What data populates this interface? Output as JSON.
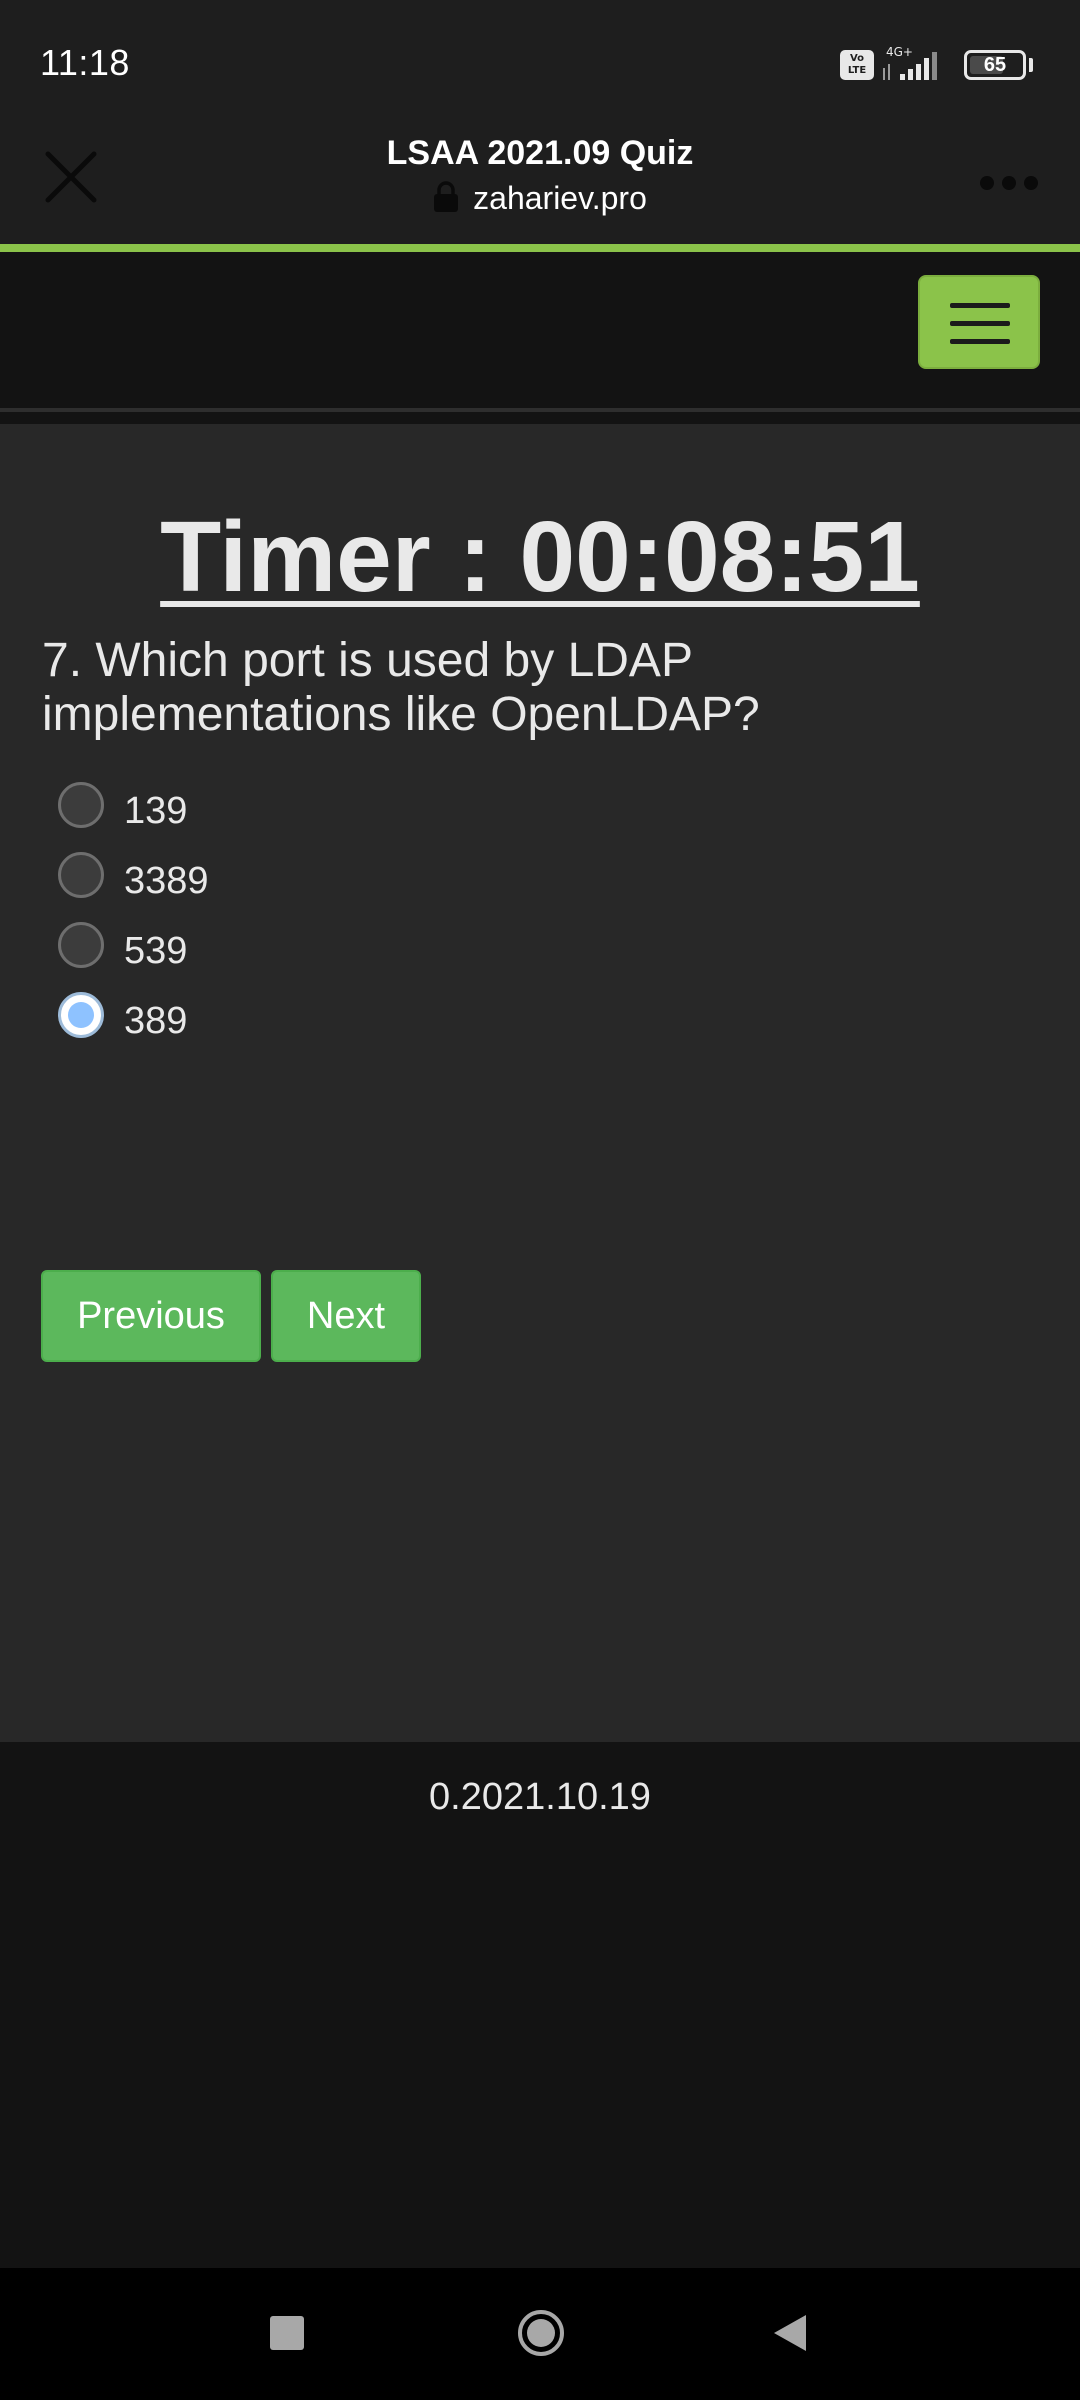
{
  "status_bar": {
    "time": "11:18",
    "volte_label": "Vo LTE",
    "network_label": "4G+",
    "battery_level": 65,
    "battery_text": "65"
  },
  "browser": {
    "page_title": "LSAA 2021.09 Quiz",
    "url": "zahariev.pro",
    "icons": [
      "close-icon",
      "lock-icon",
      "more-dots-icon"
    ]
  },
  "navbar": {
    "menu_icon": "hamburger-icon",
    "accent_color": "#8bc34a"
  },
  "quiz": {
    "timer": "Timer : 00:08:51",
    "question": "7. Which port is used by LDAP implementations like OpenLDAP?",
    "options": [
      {
        "label": "139",
        "selected": false
      },
      {
        "label": "3389",
        "selected": false
      },
      {
        "label": "539",
        "selected": false
      },
      {
        "label": "389",
        "selected": true
      }
    ],
    "previous_label": "Previous",
    "next_label": "Next",
    "button_color": "#5cb85c"
  },
  "footer": {
    "version": "0.2021.10.19"
  },
  "system_nav": {
    "icons": [
      "recents-icon",
      "home-icon",
      "back-icon"
    ]
  }
}
